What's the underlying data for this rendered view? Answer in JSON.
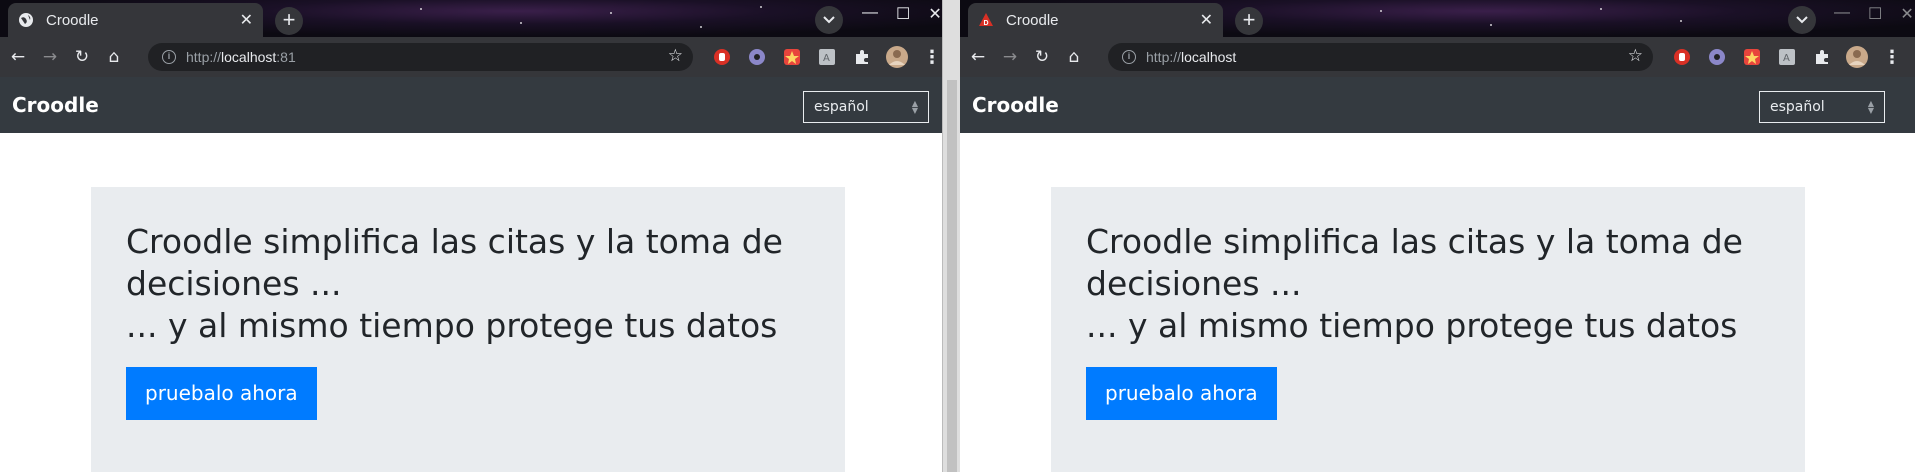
{
  "left_window": {
    "tab": {
      "title": "Croodle",
      "close": "✕"
    },
    "newtab": "+",
    "address": {
      "scheme": "http://",
      "host": "localhost",
      "port": ":81"
    },
    "page": {
      "brand": "Croodle",
      "language": "español",
      "headline_line1": "Croodle simplifica las citas y la toma de",
      "headline_line2": "decisiones ...",
      "headline_line3": "... y al mismo tiempo protege tus datos",
      "cta": "pruebalo ahora"
    }
  },
  "right_window": {
    "tab": {
      "title": "Croodle",
      "close": "✕"
    },
    "newtab": "+",
    "address": {
      "scheme": "http://",
      "host": "localhost",
      "port": ""
    },
    "page": {
      "brand": "Croodle",
      "language": "español",
      "headline_line1": "Croodle simplifica las citas y la toma de",
      "headline_line2": "decisiones ...",
      "headline_line3": "... y al mismo tiempo protege tus datos",
      "cta": "pruebalo ahora"
    }
  },
  "icons": {
    "back": "←",
    "forward": "→",
    "reload": "↻",
    "home": "⌂",
    "bookmark": "☆",
    "menu": "⋮",
    "tab_search": "⌄",
    "minimize": "—",
    "maximize": "☐",
    "close": "✕"
  },
  "colors": {
    "navbar": "#343a40",
    "jumbotron": "#e9ecef",
    "primary_button": "#007bff",
    "chrome_toolbar": "#35363a"
  }
}
